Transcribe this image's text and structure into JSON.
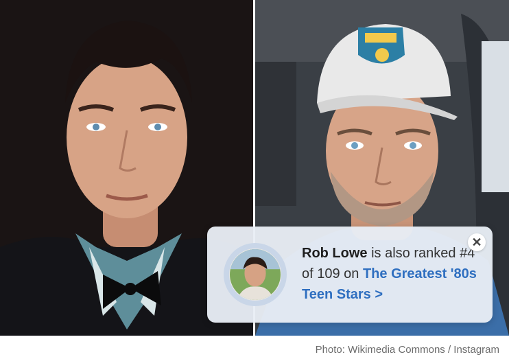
{
  "caption": "Photo: Wikimedia Commons / Instagram",
  "photos": {
    "left": {
      "subject": "young-portrait"
    },
    "right": {
      "subject": "selfie-in-cap"
    }
  },
  "rank_card": {
    "name": "Rob Lowe",
    "text_mid": " is also ranked ",
    "rank": "#4 of 109",
    "text_on": " on ",
    "list_link": "The Greatest '80s Teen Stars >",
    "close_icon": "close-icon",
    "link_color": "#2f6fc0"
  }
}
